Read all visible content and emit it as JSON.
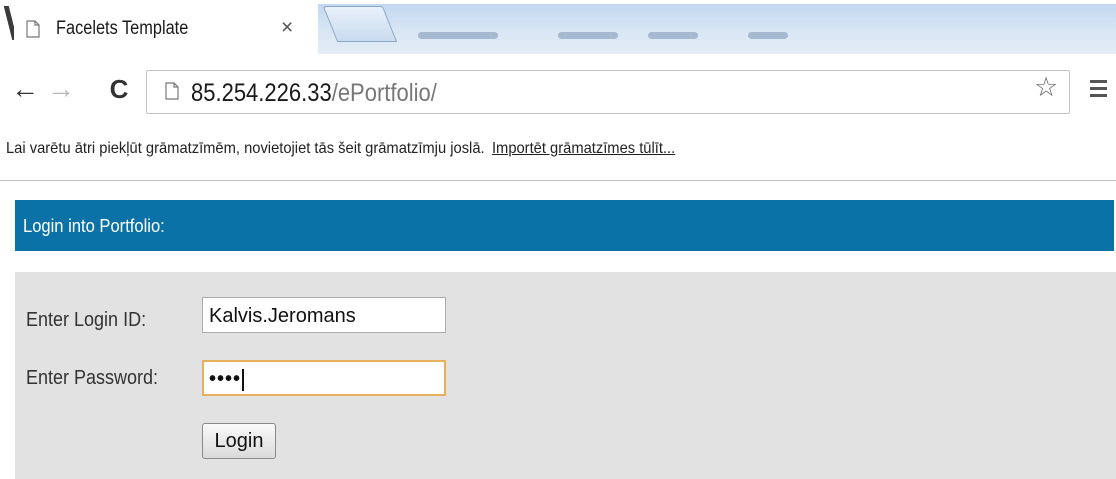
{
  "browser": {
    "tab": {
      "title": "Facelets Template",
      "close_glyph": "×",
      "icon": "page-icon"
    },
    "toolbar": {
      "back_glyph": "←",
      "forward_glyph": "→",
      "reload_glyph": "C",
      "url_host": "85.254.226.33",
      "url_path": "/ePortfolio/",
      "star_glyph": "☆"
    },
    "bookmarks_bar": {
      "message": "Lai varētu ātri piekļūt grāmatzīmēm, novietojiet tās šeit grāmatzīmju joslā.",
      "import_link": "Importēt grāmatzīmes tūlīt..."
    }
  },
  "page": {
    "panel_title": "Login into Portfolio:",
    "accent_color": "#0a72a7",
    "form": {
      "login_label": "Enter Login ID:",
      "login_value": "Kalvis.Jeromans",
      "password_label": "Enter Password:",
      "password_mask": "••••",
      "login_button": "Login"
    }
  }
}
